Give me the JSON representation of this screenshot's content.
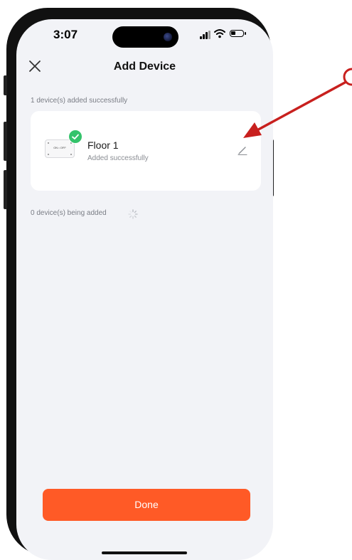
{
  "status_bar": {
    "time": "3:07"
  },
  "nav": {
    "title": "Add Device",
    "close_icon": "close-icon"
  },
  "added_section": {
    "header": "1 device(s) added successfully",
    "devices": [
      {
        "name": "Floor 1",
        "status": "Added successfully",
        "thumb_label": "ON • OFF",
        "badge_icon": "check-icon",
        "edit_icon": "pencil-icon"
      }
    ]
  },
  "adding_section": {
    "header": "0 device(s) being added",
    "spinner_icon": "spinner-icon"
  },
  "footer": {
    "done_label": "Done"
  },
  "colors": {
    "accent": "#ff5a26",
    "success": "#34c36b",
    "background": "#f2f3f7",
    "annotation": "#c8201e"
  }
}
